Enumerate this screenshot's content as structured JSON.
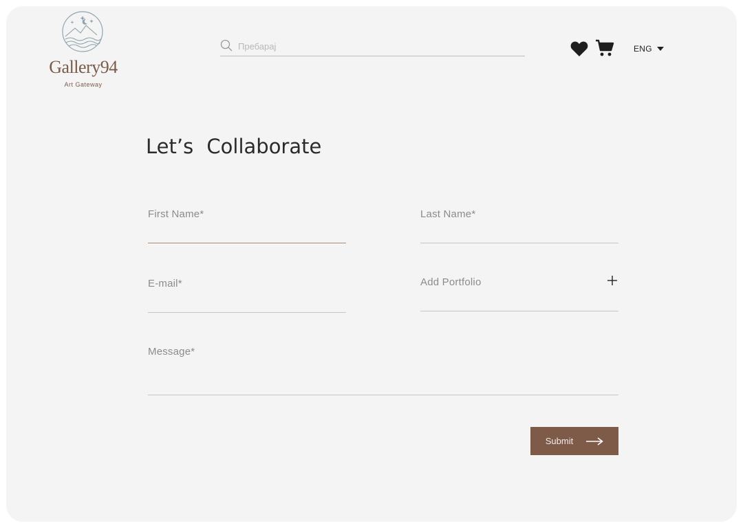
{
  "brand": {
    "name": "Gallery94",
    "tagline": "Art Gateway",
    "color": "#7a5a48"
  },
  "header": {
    "search": {
      "placeholder": "Пребарај",
      "value": "",
      "icon": "search-icon"
    },
    "wishlist_icon": "heart-icon",
    "cart_icon": "cart-icon",
    "language": {
      "selected": "ENG",
      "icon": "caret-down-icon"
    }
  },
  "form": {
    "title": "Let’s Collaborate",
    "fields": {
      "first_name": {
        "label": "First Name*",
        "value": ""
      },
      "last_name": {
        "label": "Last Name*",
        "value": ""
      },
      "email": {
        "label": "E-mail*",
        "value": ""
      },
      "portfolio": {
        "label": "Add Portfolio",
        "icon": "plus-icon"
      },
      "message": {
        "label": "Message*",
        "value": ""
      }
    },
    "submit": {
      "label": "Submit",
      "icon": "arrow-right-icon",
      "color": "#7e5b48"
    }
  },
  "colors": {
    "background": "#f4f4f4",
    "active_underline": "#a58a76",
    "label": "#8b8b8b"
  }
}
